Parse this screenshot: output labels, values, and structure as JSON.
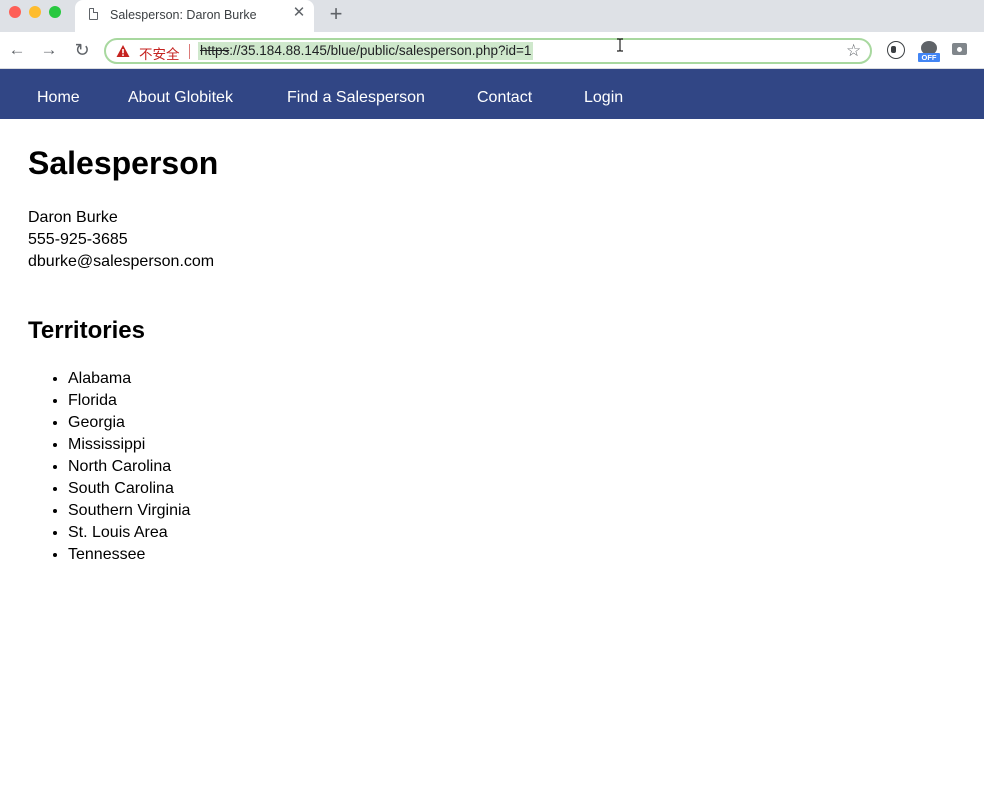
{
  "browser": {
    "tab_title": "Salesperson: Daron Burke",
    "security_label": "不安全",
    "url_scheme": "https",
    "url_rest": "://35.184.88.145/blue/public/salesperson.php?id=1",
    "close_glyph": "✕",
    "new_tab_glyph": "+",
    "back_glyph": "←",
    "forward_glyph": "→",
    "reload_glyph": "↻",
    "star_glyph": "☆",
    "extension_badge": "OFF"
  },
  "nav": {
    "items": [
      {
        "label": "Home"
      },
      {
        "label": "About Globitek"
      },
      {
        "label": "Find a Salesperson"
      },
      {
        "label": "Contact"
      },
      {
        "label": "Login"
      }
    ]
  },
  "page": {
    "title": "Salesperson",
    "name": "Daron Burke",
    "phone": "555-925-3685",
    "email": "dburke@salesperson.com",
    "territories_heading": "Territories",
    "territories": [
      "Alabama",
      "Florida",
      "Georgia",
      "Mississippi",
      "North Carolina",
      "South Carolina",
      "Southern Virginia",
      "St. Louis Area",
      "Tennessee"
    ]
  },
  "colors": {
    "nav_background": "#314685",
    "warning_red": "#c5221f",
    "omnibox_border": "#a8d89f"
  }
}
